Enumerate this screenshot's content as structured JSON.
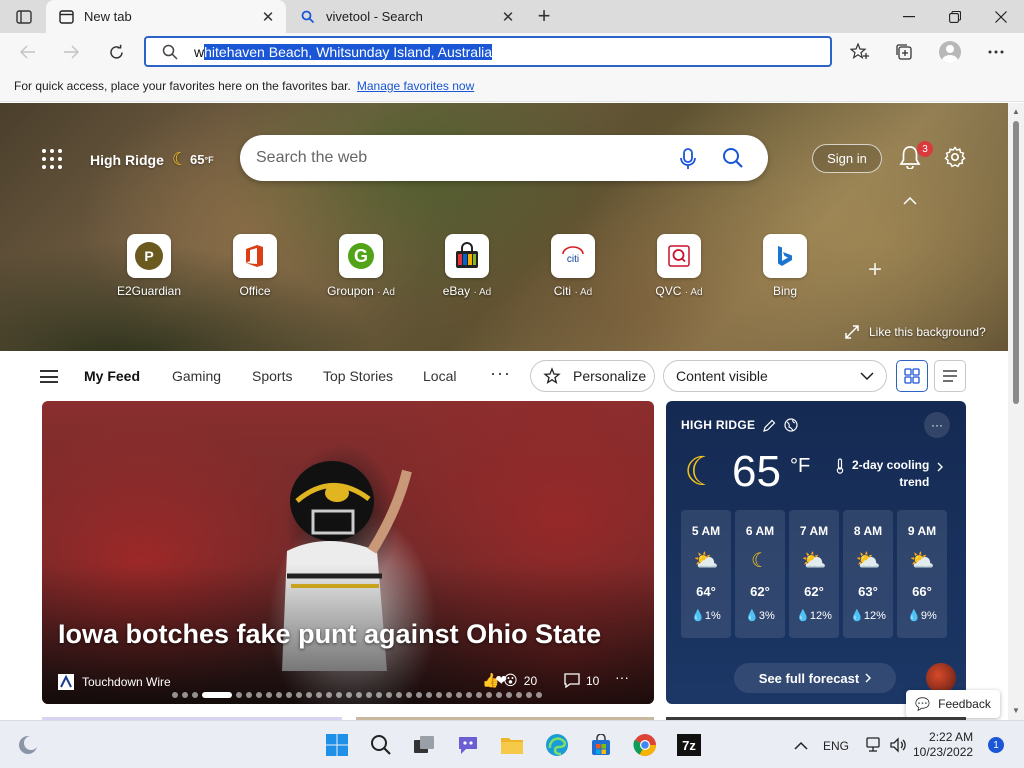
{
  "browser": {
    "tabs": [
      {
        "title": "New tab",
        "active": true
      },
      {
        "title": "vivetool - Search",
        "active": false
      }
    ],
    "address": {
      "first_char": "w",
      "selected": "hitehaven Beach, Whitsunday Island, Australia"
    },
    "favorites_bar": {
      "message": "For quick access, place your favorites here on the favorites bar.",
      "link": "Manage favorites now"
    }
  },
  "hero": {
    "location": "High Ridge",
    "temp": "65",
    "unit": "°F",
    "search_placeholder": "Search the web",
    "signin": "Sign in",
    "notification_count": "3",
    "like_background": "Like this background?",
    "quick_links": [
      {
        "label": "E2Guardian",
        "ad": ""
      },
      {
        "label": "Office",
        "ad": ""
      },
      {
        "label": "Groupon",
        "ad": "· Ad"
      },
      {
        "label": "eBay",
        "ad": "· Ad"
      },
      {
        "label": "Citi",
        "ad": "· Ad"
      },
      {
        "label": "QVC",
        "ad": "· Ad"
      },
      {
        "label": "Bing",
        "ad": ""
      }
    ]
  },
  "feed_nav": {
    "items": [
      "My Feed",
      "Gaming",
      "Sports",
      "Top Stories",
      "Local"
    ],
    "personalize": "Personalize",
    "content_visible": "Content visible"
  },
  "main_card": {
    "headline": "Iowa botches fake punt against Ohio State",
    "source": "Touchdown Wire",
    "reactions": "20",
    "comments": "10"
  },
  "weather": {
    "location": "HIGH RIDGE",
    "temp": "65",
    "unit": "°F",
    "trend_line1": "2-day cooling",
    "trend_line2": "trend",
    "hours": [
      {
        "time": "5 AM",
        "icon": "partly-cloudy-night-icon",
        "temp": "64°",
        "precip": "1%"
      },
      {
        "time": "6 AM",
        "icon": "moon-cloud-icon",
        "temp": "62°",
        "precip": "3%"
      },
      {
        "time": "7 AM",
        "icon": "partly-cloudy-icon",
        "temp": "62°",
        "precip": "12%"
      },
      {
        "time": "8 AM",
        "icon": "sun-cloud-icon",
        "temp": "63°",
        "precip": "12%"
      },
      {
        "time": "9 AM",
        "icon": "sun-cloud-icon",
        "temp": "66°",
        "precip": "9%"
      }
    ],
    "forecast_button": "See full forecast"
  },
  "feedback": "Feedback",
  "taskbar": {
    "language": "ENG",
    "time": "2:22 AM",
    "date": "10/23/2022",
    "notifications": "1"
  }
}
